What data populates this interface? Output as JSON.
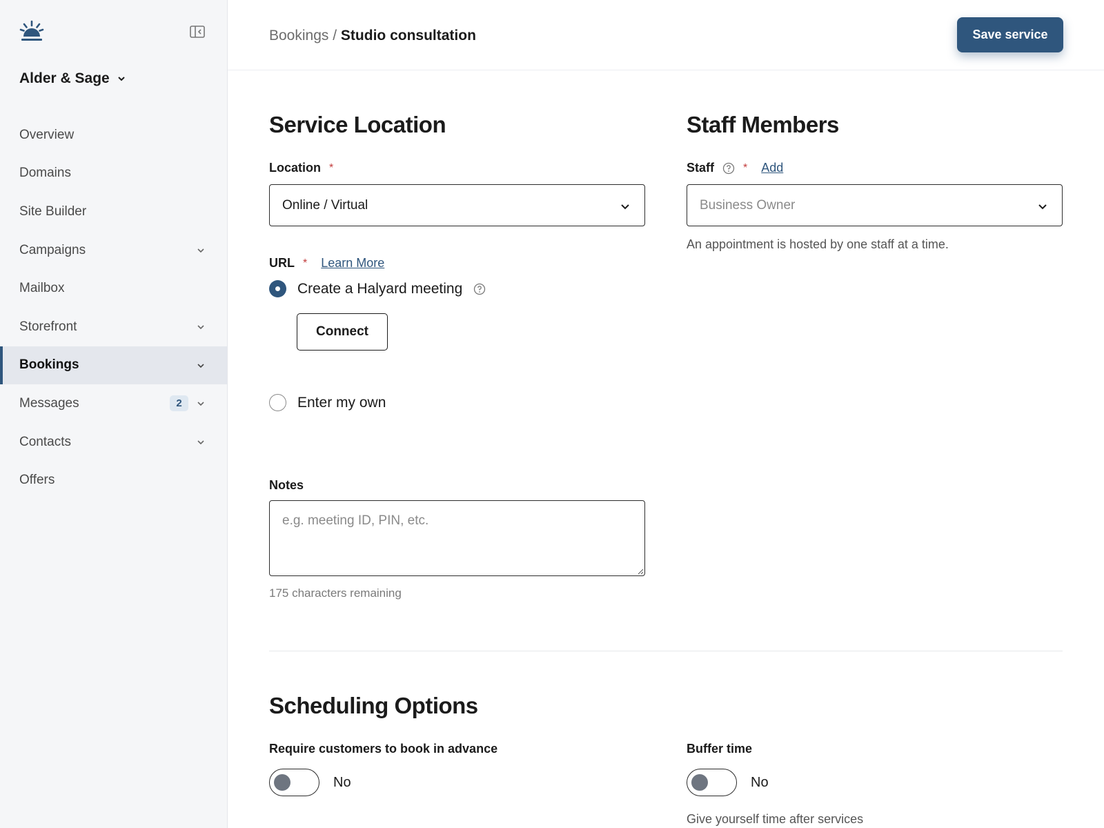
{
  "sidebar": {
    "brand_name": "Alder & Sage",
    "items": [
      {
        "label": "Overview"
      },
      {
        "label": "Domains"
      },
      {
        "label": "Site Builder"
      },
      {
        "label": "Campaigns"
      },
      {
        "label": "Mailbox"
      },
      {
        "label": "Storefront"
      },
      {
        "label": "Bookings"
      },
      {
        "label": "Messages",
        "badge": "2"
      },
      {
        "label": "Contacts"
      },
      {
        "label": "Offers"
      }
    ]
  },
  "header": {
    "breadcrumb_parent": "Bookings",
    "breadcrumb_separator": "/",
    "breadcrumb_current": "Studio consultation",
    "save_label": "Save service"
  },
  "service_location": {
    "title": "Service Location",
    "location_label": "Location",
    "required_mark": "*",
    "location_value": "Online / Virtual",
    "url_label": "URL",
    "learn_more": "Learn More",
    "option_create": "Create a Halyard meeting",
    "connect_label": "Connect",
    "option_own": "Enter my own",
    "notes_label": "Notes",
    "notes_placeholder": "e.g. meeting ID, PIN, etc.",
    "notes_remaining": "175 characters remaining"
  },
  "staff_members": {
    "title": "Staff Members",
    "staff_label": "Staff",
    "required_mark": "*",
    "add_link": "Add",
    "staff_placeholder": "Business Owner",
    "helper": "An appointment is hosted by one staff at a time."
  },
  "scheduling": {
    "title": "Scheduling Options",
    "advance_label": "Require customers to book in advance",
    "advance_value": "No",
    "buffer_label": "Buffer time",
    "buffer_value": "No",
    "buffer_helper": "Give yourself time after services"
  },
  "colors": {
    "accent": "#2f567d",
    "required": "#c23b3b",
    "sidebar_bg": "#f5f6f8"
  }
}
